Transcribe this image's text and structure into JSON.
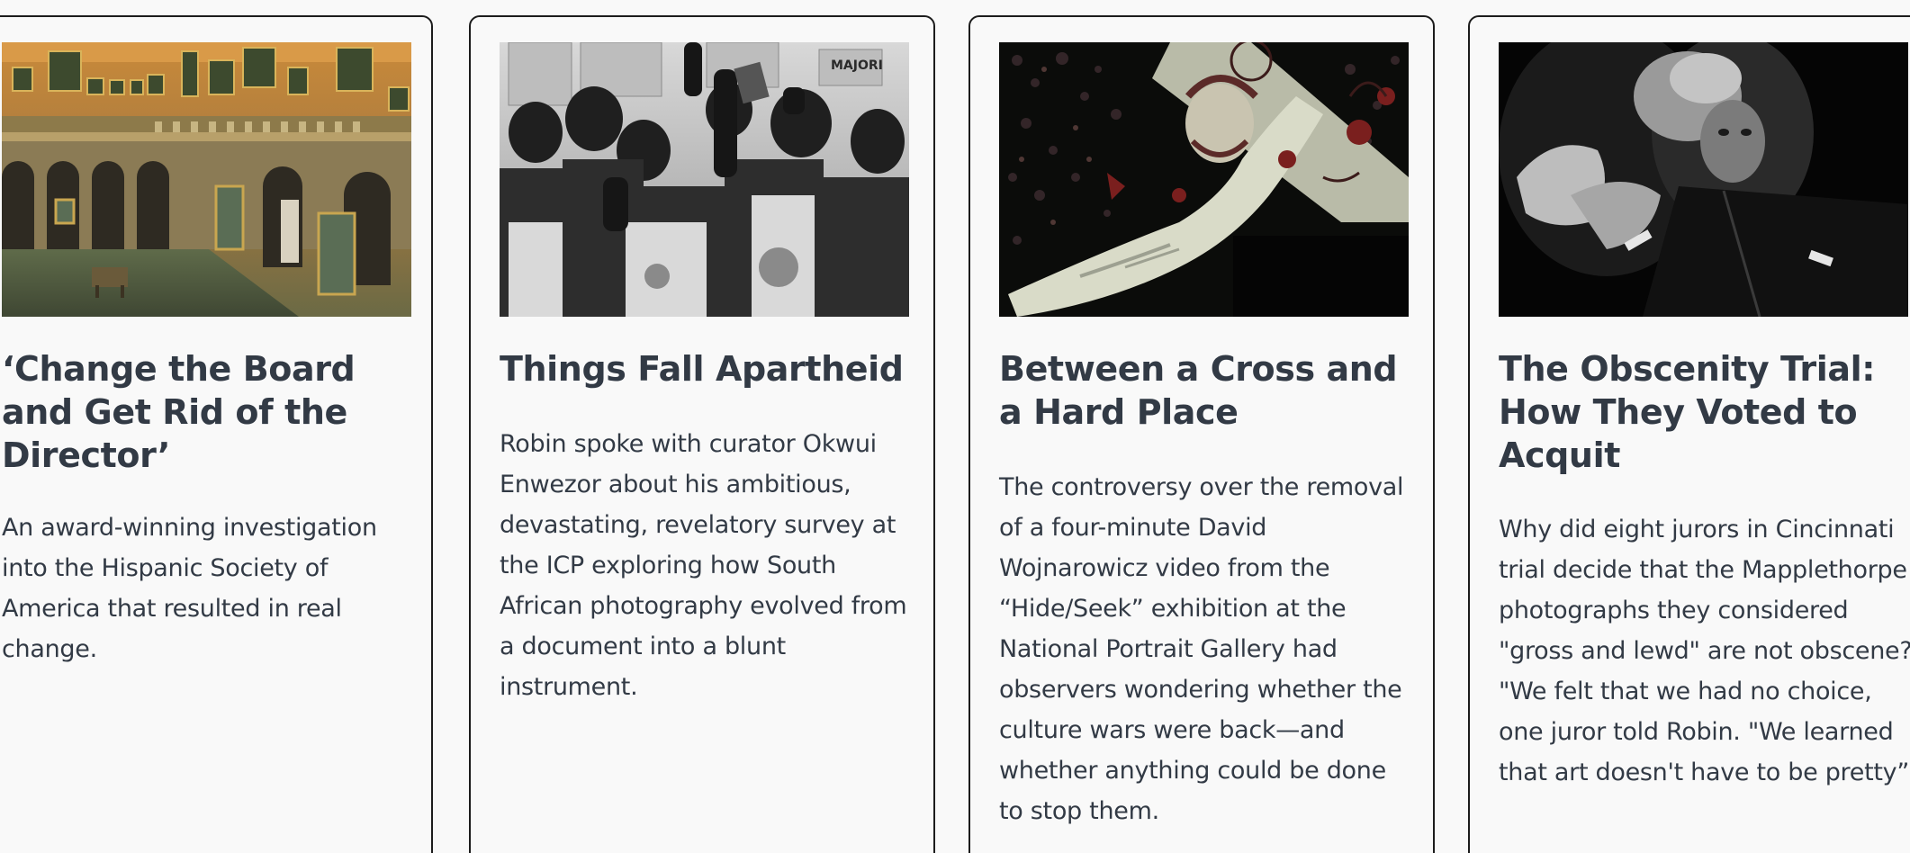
{
  "cards": [
    {
      "title": "‘Change the Board and Get Rid of the Director’",
      "description": "An award-winning investigation into the Hispanic Society of America that resulted in real change.",
      "image": "gallery-interior-photo"
    },
    {
      "title": "Things Fall Apartheid",
      "description": "Robin spoke with curator Okwui Enwezor about his ambitious, devastating, revelatory survey at the ICP exploring how South African photography evolved from a document into a blunt instrument.",
      "image": "protest-crowd-photo"
    },
    {
      "title": "Between a Cross and a Hard Place",
      "description": "The controversy over the removal of a four-minute David Wojnarowicz video from the “Hide/Seek” exhibition at the National Portrait Gallery had observers wondering whether the culture wars were back—and whether anything could be done to stop them.",
      "image": "crucifix-video-still"
    },
    {
      "title": "The Obscenity Trial: How They Voted to Acquit",
      "description": "Why did eight jurors in Cincinnati trial decide that the Mapplethorpe photographs they considered \"gross and lewd\" are not obscene? \"We felt that we had no choice, one juror told Robin. \"We learned that art doesn't have to be pretty”",
      "image": "embrace-photo"
    }
  ],
  "colors": {
    "background": "#f9f9f9",
    "text": "#323a45",
    "card_border": "#1c1c1c"
  }
}
